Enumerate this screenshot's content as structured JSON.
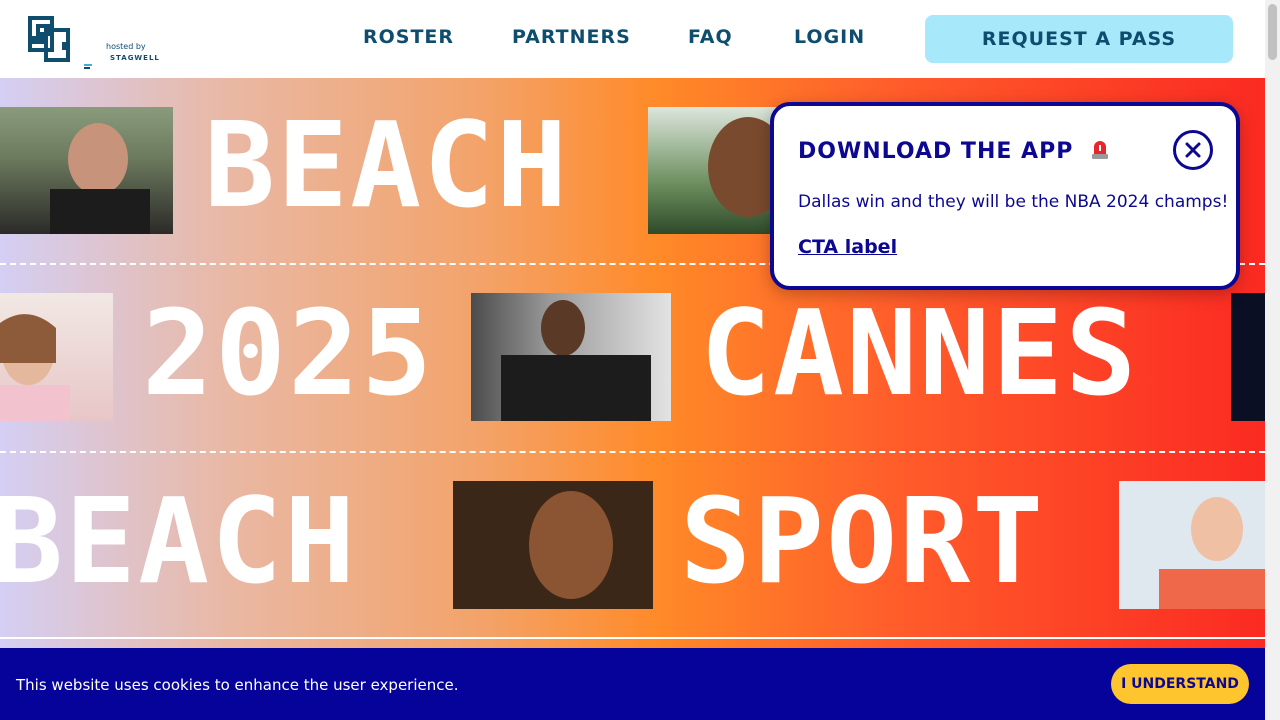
{
  "header": {
    "logo": {
      "hosted_by": "hosted by",
      "stagwell": "STAGWELL"
    },
    "nav": [
      {
        "label": "ROSTER"
      },
      {
        "label": "PARTNERS"
      },
      {
        "label": "FAQ"
      },
      {
        "label": "LOGIN"
      }
    ],
    "cta_label": "REQUEST A PASS"
  },
  "hero": {
    "row1": {
      "word": "BEACH"
    },
    "row2": {
      "words": [
        "2025",
        "CANNES"
      ]
    },
    "row3": {
      "words": [
        "BEACH",
        "SPORT"
      ]
    }
  },
  "popup": {
    "title": "DOWNLOAD THE APP",
    "icon": "siren-icon",
    "text": "Dallas win and they will be the NBA 2024 champs!",
    "cta": "CTA label"
  },
  "cookie": {
    "text": "This website uses cookies to enhance the user experience.",
    "button": "I UNDERSTAND"
  },
  "colors": {
    "brand_teal": "#0e4d6e",
    "pass_button": "#a8e8fb",
    "popup_navy": "#0c0892",
    "cookie_bar": "#06039a",
    "cookie_button": "#ffc52e"
  }
}
